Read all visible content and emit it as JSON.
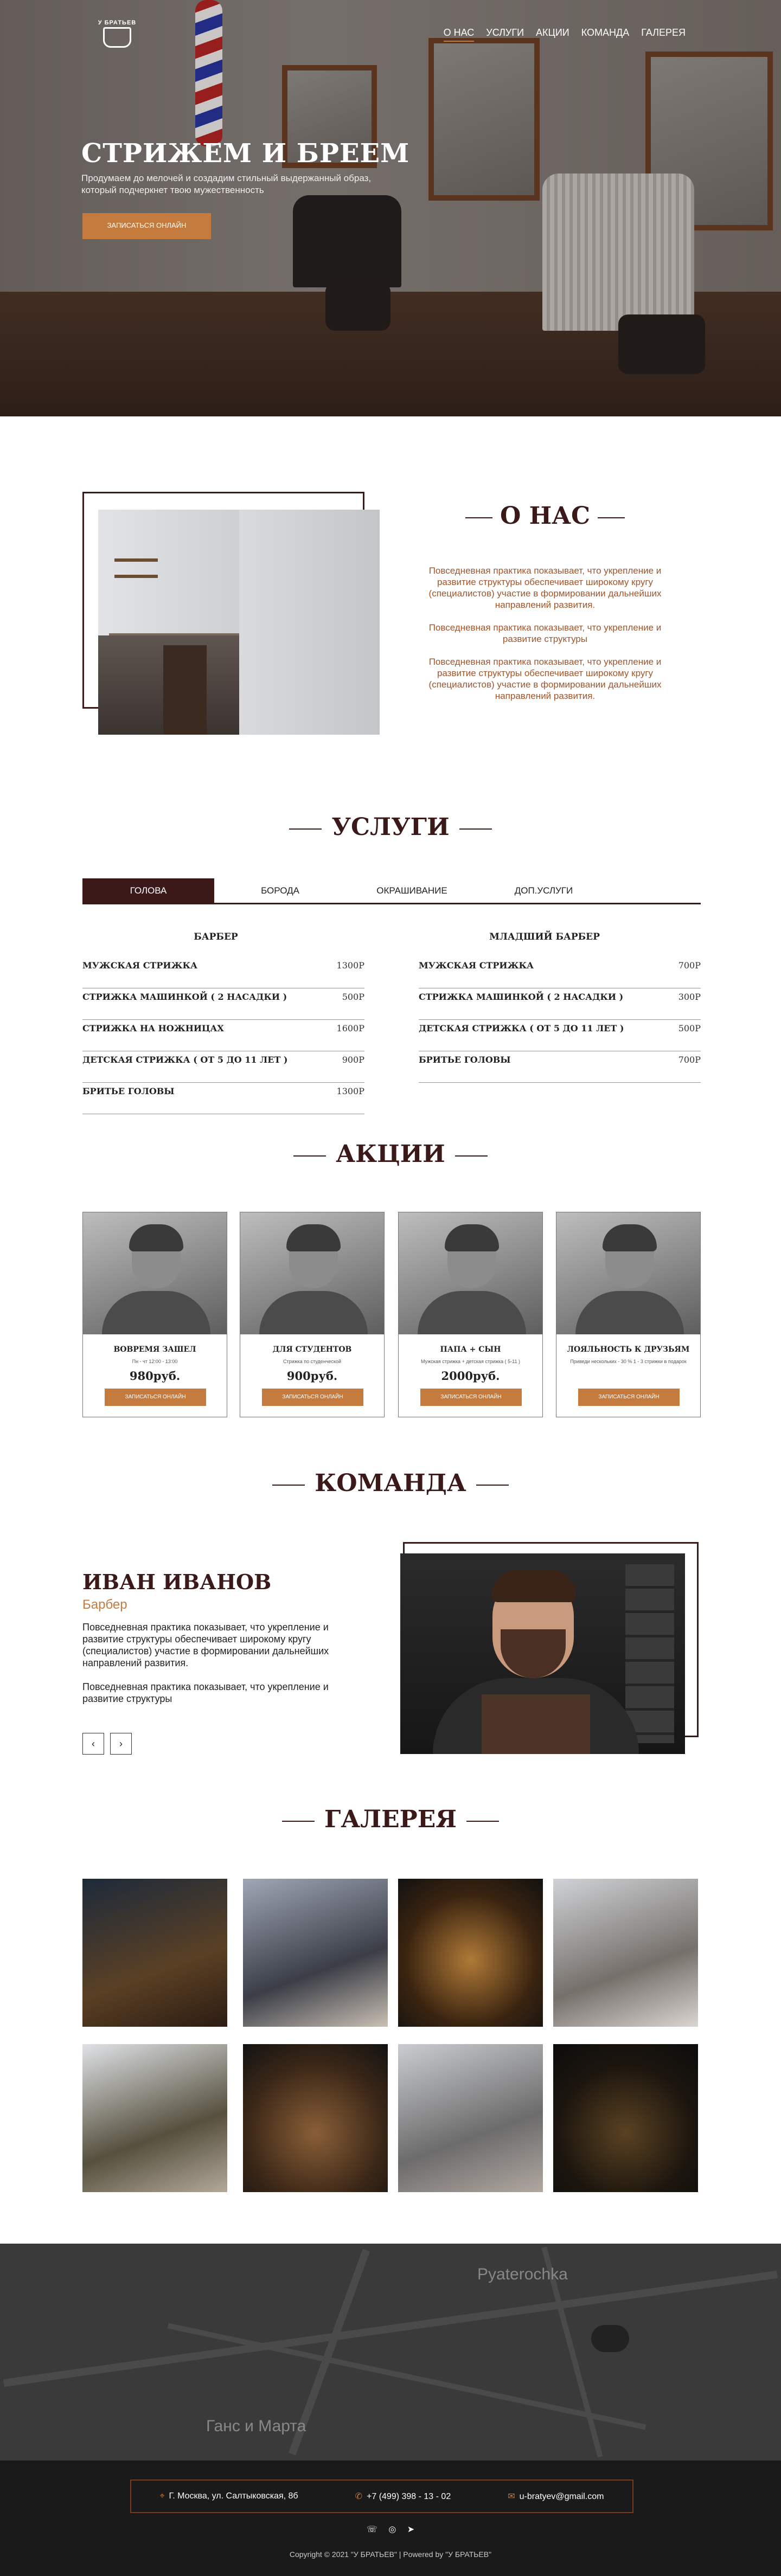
{
  "brand": {
    "logo_text": "У БРАТЬЕВ"
  },
  "nav": [
    "О НАС",
    "УСЛУГИ",
    "АКЦИИ",
    "КОМАНДА",
    "ГАЛЕРЕЯ"
  ],
  "hero": {
    "title": "СТРИЖЕМ И БРЕЕМ",
    "subtitle": "Продумаем до мелочей и создадим стильный выдержанный образ, который подчеркнет твою мужественность",
    "button": "ЗАПИСАТЬСЯ ОНЛАЙН"
  },
  "about": {
    "title": "О НАС",
    "paragraphs": [
      "Повседневная практика показывает, что укрепление и развитие структуры обеспечивает широкому кругу (специалистов) участие в формировании дальнейших направлений развития.",
      "Повседневная практика показывает, что укрепление и развитие структуры",
      "Повседневная практика показывает, что укрепление и развитие структуры обеспечивает широкому кругу (специалистов) участие в формировании дальнейших направлений развития."
    ]
  },
  "services": {
    "title": "УСЛУГИ",
    "tabs": [
      "ГОЛОВА",
      "БОРОДА",
      "ОКРАШИВАНИЕ",
      "ДОП.УСЛУГИ"
    ],
    "left": {
      "heading": "БАРБЕР",
      "items": [
        {
          "name": "МУЖСКАЯ СТРИЖКА",
          "price": "1300Р"
        },
        {
          "name": "СТРИЖКА МАШИНКОЙ ( 2 НАСАДКИ )",
          "price": "500Р"
        },
        {
          "name": "СТРИЖКА НА НОЖНИЦАХ",
          "price": "1600Р"
        },
        {
          "name": "ДЕТСКАЯ СТРИЖКА ( ОТ 5 ДО 11 ЛЕТ )",
          "price": "900Р"
        },
        {
          "name": "БРИТЬЕ ГОЛОВЫ",
          "price": "1300Р"
        }
      ]
    },
    "right": {
      "heading": "МЛАДШИЙ БАРБЕР",
      "items": [
        {
          "name": "МУЖСКАЯ СТРИЖКА",
          "price": "700Р"
        },
        {
          "name": "СТРИЖКА МАШИНКОЙ ( 2 НАСАДКИ )",
          "price": "300Р"
        },
        {
          "name": "ДЕТСКАЯ СТРИЖКА ( ОТ 5 ДО 11 ЛЕТ )",
          "price": "500Р"
        },
        {
          "name": "БРИТЬЕ ГОЛОВЫ",
          "price": "700Р"
        }
      ]
    }
  },
  "promos": {
    "title": "АКЦИИ",
    "button": "ЗАПИСАТЬСЯ ОНЛАЙН",
    "cards": [
      {
        "title": "ВОВРЕМЯ ЗАШЕЛ",
        "desc": "Пн - чт 12:00 - 13:00",
        "price": "980руб."
      },
      {
        "title": "ДЛЯ СТУДЕНТОВ",
        "desc": "Стрижка по студенческой",
        "price": "900руб."
      },
      {
        "title": "ПАПА + СЫН",
        "desc": "Мужская стрижка + детская стрижка ( 5-11 )",
        "price": "2000руб."
      },
      {
        "title": "ЛОЯЛЬНОСТЬ К ДРУЗЬЯМ",
        "desc": "Приведи нескольких - 30 % 1 - 3 стрижки в подарок",
        "price": ""
      }
    ]
  },
  "team": {
    "title": "КОМАНДА",
    "name": "ИВАН ИВАНОВ",
    "role": "Барбер",
    "paragraphs": [
      "Повседневная практика показывает, что укрепление и развитие структуры обеспечивает широкому кругу (специалистов) участие в формировании дальнейших направлений развития.",
      "Повседневная практика показывает, что укрепление и развитие структуры"
    ],
    "prev": "‹",
    "next": "›"
  },
  "gallery": {
    "title": "ГАЛЕРЕЯ"
  },
  "map": {
    "labels": [
      "Pyaterochka",
      "Ганс и Марта"
    ]
  },
  "footer": {
    "address": "Г. Москва, ул. Салтыковская, 8б",
    "phone": "+7 (499) 398 - 13 - 02",
    "email": "u-bratyev@gmail.com",
    "copyright": "Copyright © 2021 \"У БРАТЬЕВ\" | Powered by \"У БРАТЬЕВ\""
  },
  "colors": {
    "accent": "#c57b3e",
    "dark": "#3b1919"
  }
}
